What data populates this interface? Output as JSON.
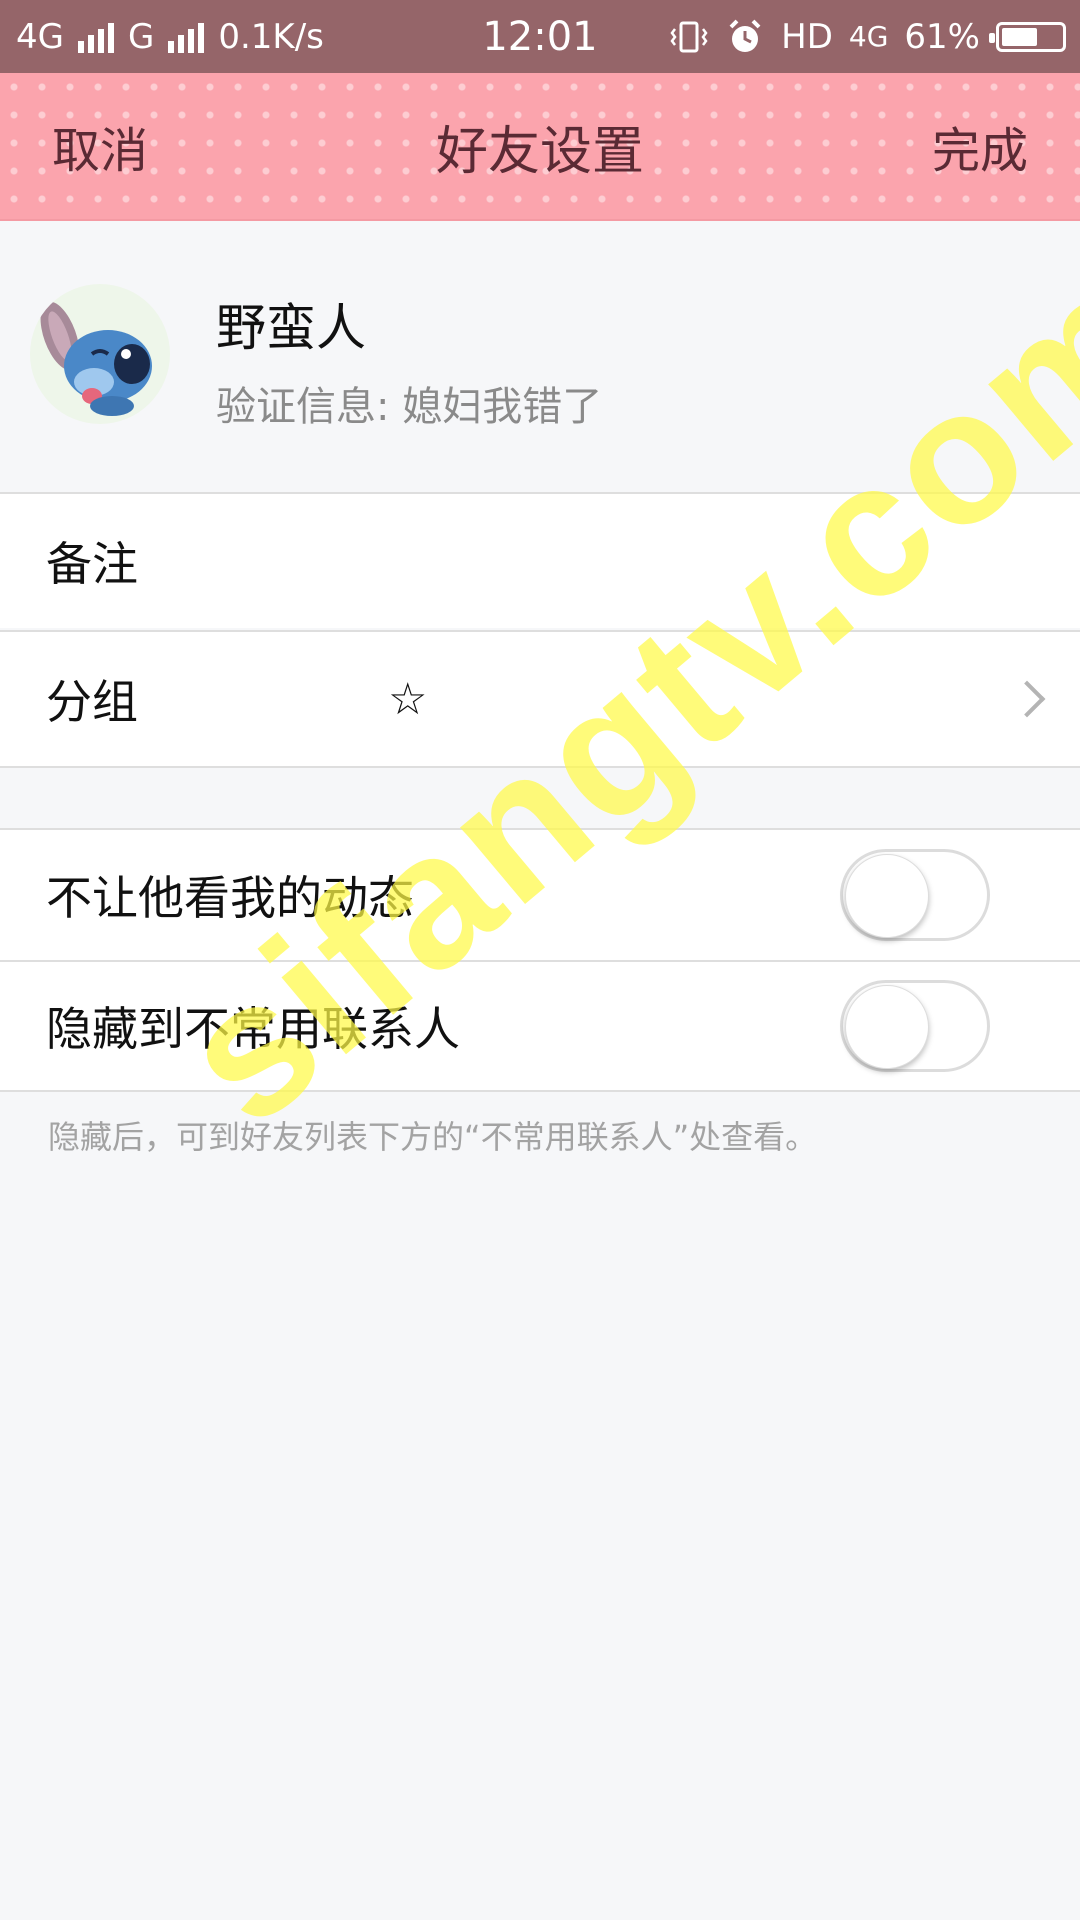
{
  "status_bar": {
    "network1": "4G",
    "network2": "G",
    "speed": "0.1K/s",
    "time": "12:01",
    "hd": "HD",
    "network3": "4G",
    "battery": "61%",
    "battery_level": 0.61
  },
  "nav": {
    "cancel": "取消",
    "title": "好友设置",
    "done": "完成"
  },
  "profile": {
    "name": "野蛮人",
    "verify": "验证信息: 媳妇我错了"
  },
  "rows": {
    "remark_label": "备注",
    "group_label": "分组",
    "group_value": "☆",
    "hide_moments_label": "不让他看我的动态",
    "hide_contact_label": "隐藏到不常用联系人"
  },
  "toggles": {
    "hide_moments": false,
    "hide_contact": false
  },
  "hint": "隐藏后，可到好友列表下方的“不常用联系人”处查看。",
  "watermark": "sifangtv.com"
}
